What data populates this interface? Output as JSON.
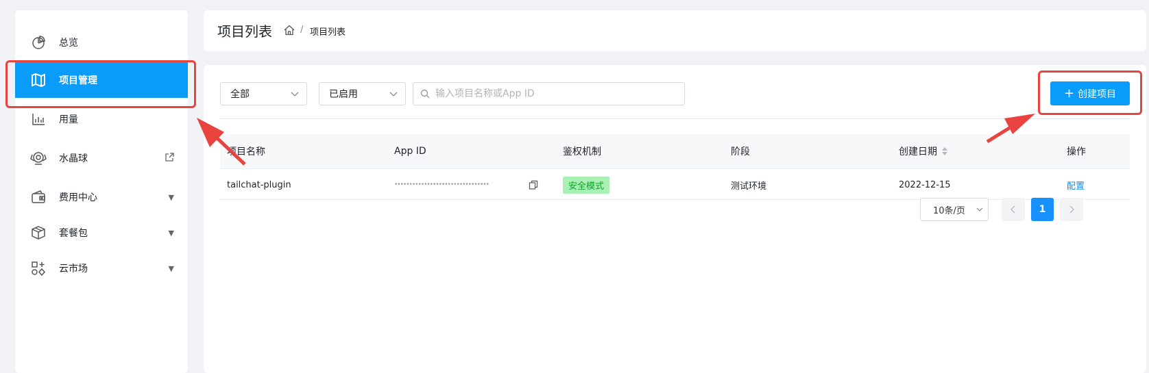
{
  "sidebar": {
    "items": [
      {
        "label": "总览",
        "icon": "pie-chart-icon"
      },
      {
        "label": "项目管理",
        "icon": "map-icon"
      },
      {
        "label": "用量",
        "icon": "bar-chart-icon"
      },
      {
        "label": "水晶球",
        "icon": "crystal-ball-icon"
      },
      {
        "label": "费用中心",
        "icon": "wallet-icon"
      },
      {
        "label": "套餐包",
        "icon": "package-icon"
      },
      {
        "label": "云市场",
        "icon": "apps-icon"
      }
    ]
  },
  "header": {
    "title": "项目列表",
    "breadcrumb_current": "项目列表"
  },
  "filters": {
    "scope_value": "全部",
    "status_value": "已启用",
    "search_placeholder": "输入项目名称或App ID"
  },
  "toolbar": {
    "create_label": "创建项目"
  },
  "table": {
    "columns": [
      "项目名称",
      "App ID",
      "鉴权机制",
      "阶段",
      "创建日期",
      "操作"
    ],
    "rows": [
      {
        "name": "tailchat-plugin",
        "app_id": "••••••••••••••••••••••••••••••••",
        "auth": "安全模式",
        "stage": "测试环境",
        "date": "2022-12-15",
        "action": "配置"
      }
    ]
  },
  "pagination": {
    "page_size": "10条/页",
    "current_page": "1"
  },
  "colors": {
    "primary": "#0a9cfa",
    "annotation": "#e8433f",
    "tag_bg": "#a9f0b4",
    "tag_text": "#12a12b"
  }
}
